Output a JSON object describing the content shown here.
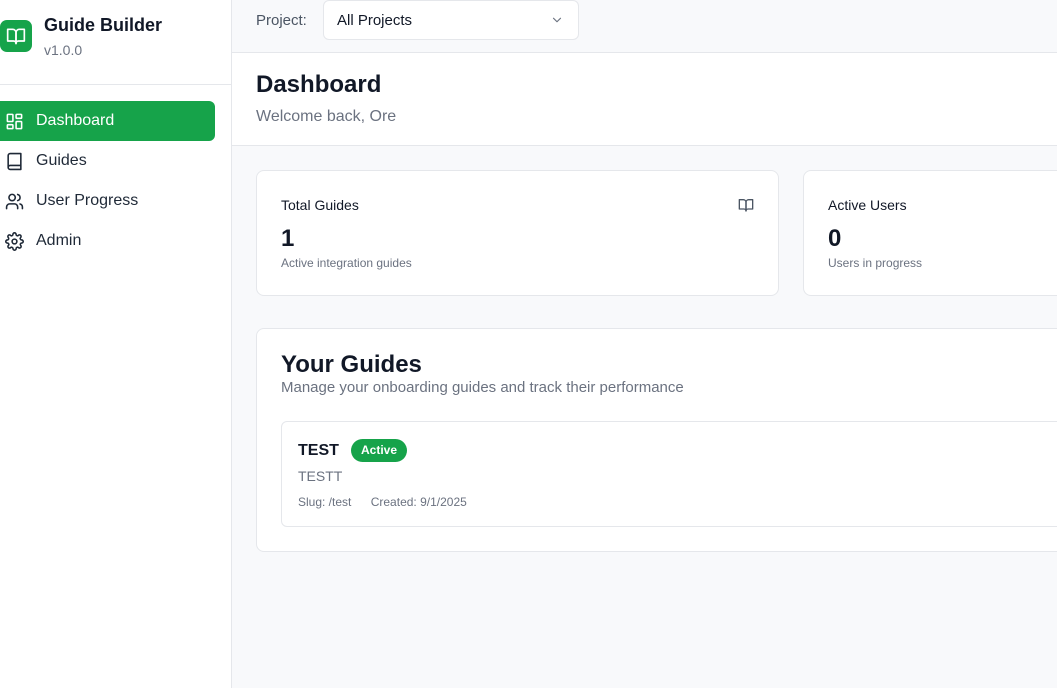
{
  "app": {
    "title": "Guide Builder",
    "version": "v1.0.0",
    "logo_icon": "book-open-icon",
    "accent_color": "#16a34a"
  },
  "sidebar": {
    "items": [
      {
        "label": "Dashboard",
        "icon": "dashboard-grid-icon",
        "active": true
      },
      {
        "label": "Guides",
        "icon": "book-icon",
        "active": false
      },
      {
        "label": "User Progress",
        "icon": "users-icon",
        "active": false
      },
      {
        "label": "Admin",
        "icon": "gear-icon",
        "active": false
      }
    ]
  },
  "topbar": {
    "project_label": "Project:",
    "project_value": "All Projects"
  },
  "header": {
    "title": "Dashboard",
    "subtitle": "Welcome back, Ore"
  },
  "stats": [
    {
      "title": "Total Guides",
      "value": "1",
      "description": "Active integration guides",
      "icon": "book-open-icon"
    },
    {
      "title": "Active Users",
      "value": "0",
      "description": "Users in progress"
    }
  ],
  "guides": {
    "title": "Your Guides",
    "subtitle": "Manage your onboarding guides and track their performance",
    "items": [
      {
        "name": "TEST",
        "status": "Active",
        "description": "TESTT",
        "slug": "Slug: /test",
        "created": "Created: 9/1/2025"
      }
    ]
  }
}
